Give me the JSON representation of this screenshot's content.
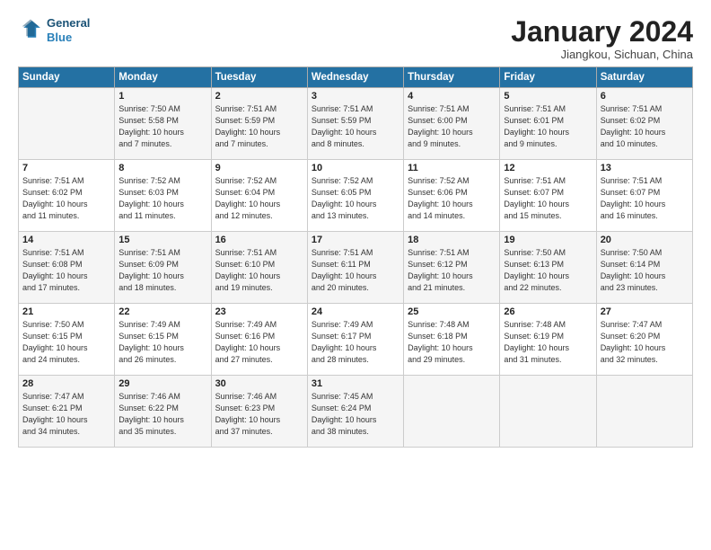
{
  "header": {
    "logo_line1": "General",
    "logo_line2": "Blue",
    "month": "January 2024",
    "location": "Jiangkou, Sichuan, China"
  },
  "days_of_week": [
    "Sunday",
    "Monday",
    "Tuesday",
    "Wednesday",
    "Thursday",
    "Friday",
    "Saturday"
  ],
  "weeks": [
    [
      {
        "num": "",
        "info": ""
      },
      {
        "num": "1",
        "info": "Sunrise: 7:50 AM\nSunset: 5:58 PM\nDaylight: 10 hours\nand 7 minutes."
      },
      {
        "num": "2",
        "info": "Sunrise: 7:51 AM\nSunset: 5:59 PM\nDaylight: 10 hours\nand 7 minutes."
      },
      {
        "num": "3",
        "info": "Sunrise: 7:51 AM\nSunset: 5:59 PM\nDaylight: 10 hours\nand 8 minutes."
      },
      {
        "num": "4",
        "info": "Sunrise: 7:51 AM\nSunset: 6:00 PM\nDaylight: 10 hours\nand 9 minutes."
      },
      {
        "num": "5",
        "info": "Sunrise: 7:51 AM\nSunset: 6:01 PM\nDaylight: 10 hours\nand 9 minutes."
      },
      {
        "num": "6",
        "info": "Sunrise: 7:51 AM\nSunset: 6:02 PM\nDaylight: 10 hours\nand 10 minutes."
      }
    ],
    [
      {
        "num": "7",
        "info": "Sunrise: 7:51 AM\nSunset: 6:02 PM\nDaylight: 10 hours\nand 11 minutes."
      },
      {
        "num": "8",
        "info": "Sunrise: 7:52 AM\nSunset: 6:03 PM\nDaylight: 10 hours\nand 11 minutes."
      },
      {
        "num": "9",
        "info": "Sunrise: 7:52 AM\nSunset: 6:04 PM\nDaylight: 10 hours\nand 12 minutes."
      },
      {
        "num": "10",
        "info": "Sunrise: 7:52 AM\nSunset: 6:05 PM\nDaylight: 10 hours\nand 13 minutes."
      },
      {
        "num": "11",
        "info": "Sunrise: 7:52 AM\nSunset: 6:06 PM\nDaylight: 10 hours\nand 14 minutes."
      },
      {
        "num": "12",
        "info": "Sunrise: 7:51 AM\nSunset: 6:07 PM\nDaylight: 10 hours\nand 15 minutes."
      },
      {
        "num": "13",
        "info": "Sunrise: 7:51 AM\nSunset: 6:07 PM\nDaylight: 10 hours\nand 16 minutes."
      }
    ],
    [
      {
        "num": "14",
        "info": "Sunrise: 7:51 AM\nSunset: 6:08 PM\nDaylight: 10 hours\nand 17 minutes."
      },
      {
        "num": "15",
        "info": "Sunrise: 7:51 AM\nSunset: 6:09 PM\nDaylight: 10 hours\nand 18 minutes."
      },
      {
        "num": "16",
        "info": "Sunrise: 7:51 AM\nSunset: 6:10 PM\nDaylight: 10 hours\nand 19 minutes."
      },
      {
        "num": "17",
        "info": "Sunrise: 7:51 AM\nSunset: 6:11 PM\nDaylight: 10 hours\nand 20 minutes."
      },
      {
        "num": "18",
        "info": "Sunrise: 7:51 AM\nSunset: 6:12 PM\nDaylight: 10 hours\nand 21 minutes."
      },
      {
        "num": "19",
        "info": "Sunrise: 7:50 AM\nSunset: 6:13 PM\nDaylight: 10 hours\nand 22 minutes."
      },
      {
        "num": "20",
        "info": "Sunrise: 7:50 AM\nSunset: 6:14 PM\nDaylight: 10 hours\nand 23 minutes."
      }
    ],
    [
      {
        "num": "21",
        "info": "Sunrise: 7:50 AM\nSunset: 6:15 PM\nDaylight: 10 hours\nand 24 minutes."
      },
      {
        "num": "22",
        "info": "Sunrise: 7:49 AM\nSunset: 6:15 PM\nDaylight: 10 hours\nand 26 minutes."
      },
      {
        "num": "23",
        "info": "Sunrise: 7:49 AM\nSunset: 6:16 PM\nDaylight: 10 hours\nand 27 minutes."
      },
      {
        "num": "24",
        "info": "Sunrise: 7:49 AM\nSunset: 6:17 PM\nDaylight: 10 hours\nand 28 minutes."
      },
      {
        "num": "25",
        "info": "Sunrise: 7:48 AM\nSunset: 6:18 PM\nDaylight: 10 hours\nand 29 minutes."
      },
      {
        "num": "26",
        "info": "Sunrise: 7:48 AM\nSunset: 6:19 PM\nDaylight: 10 hours\nand 31 minutes."
      },
      {
        "num": "27",
        "info": "Sunrise: 7:47 AM\nSunset: 6:20 PM\nDaylight: 10 hours\nand 32 minutes."
      }
    ],
    [
      {
        "num": "28",
        "info": "Sunrise: 7:47 AM\nSunset: 6:21 PM\nDaylight: 10 hours\nand 34 minutes."
      },
      {
        "num": "29",
        "info": "Sunrise: 7:46 AM\nSunset: 6:22 PM\nDaylight: 10 hours\nand 35 minutes."
      },
      {
        "num": "30",
        "info": "Sunrise: 7:46 AM\nSunset: 6:23 PM\nDaylight: 10 hours\nand 37 minutes."
      },
      {
        "num": "31",
        "info": "Sunrise: 7:45 AM\nSunset: 6:24 PM\nDaylight: 10 hours\nand 38 minutes."
      },
      {
        "num": "",
        "info": ""
      },
      {
        "num": "",
        "info": ""
      },
      {
        "num": "",
        "info": ""
      }
    ]
  ]
}
